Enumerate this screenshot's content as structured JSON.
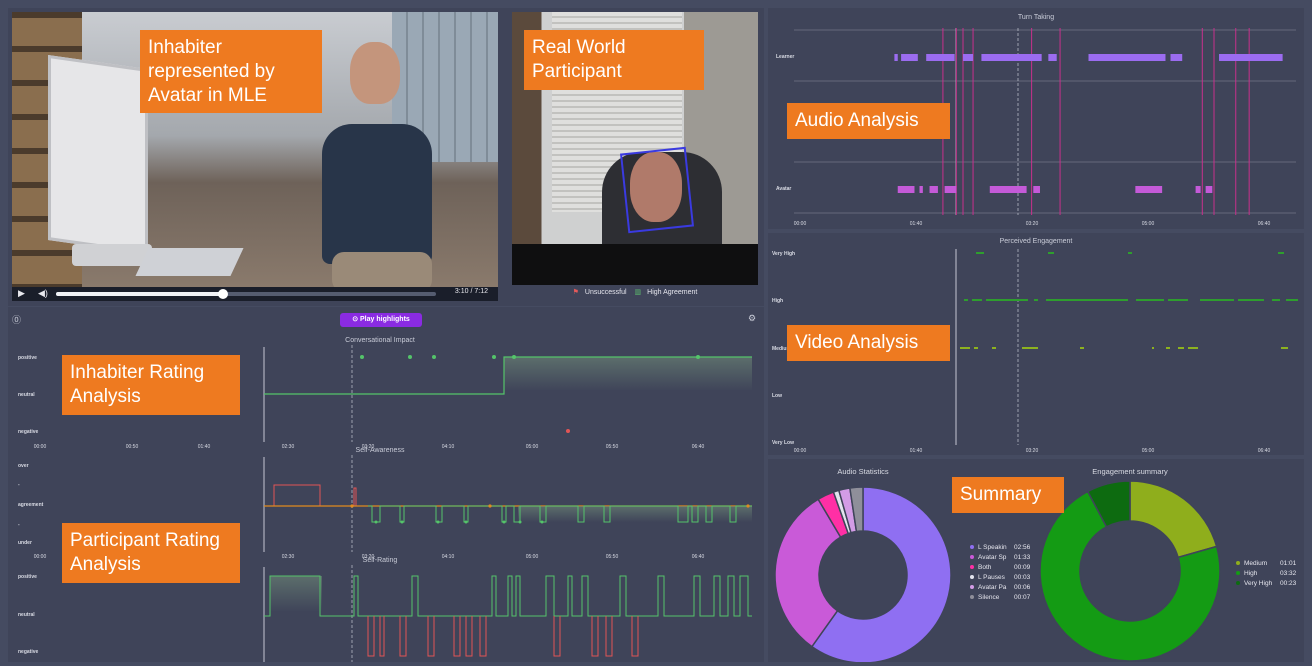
{
  "video_player": {
    "play_icon": "play-icon",
    "volume_icon": "volume-icon",
    "time_current": "3:10",
    "time_separator": "/",
    "time_total": "7:12",
    "progress_fraction": 0.44
  },
  "camera": {
    "legend_unsuccessful": "Unsuccessful",
    "legend_high_agreement": "High Agreement"
  },
  "toolbar": {
    "play_highlights": "Play highlights",
    "help_icon": "help-icon",
    "settings_icon": "gear-icon"
  },
  "overlays": {
    "inhabiter_avatar": "Inhabiter represented by Avatar in MLE",
    "real_world": "Real World Participant",
    "audio_analysis": "Audio Analysis",
    "video_analysis": "Video Analysis",
    "inhabiter_rating": "Inhabiter Rating Analysis",
    "participant_rating": "Participant Rating Analysis",
    "summary": "Summary"
  },
  "colors": {
    "accent_purple": "#8a2be2",
    "overlay_orange": "#ee7a20",
    "learner": "#9b6cf0",
    "avatar": "#c45ad8",
    "engagement_green": "#2e9e2e",
    "engagement_lime": "#8db21f",
    "rating_green": "#54c46a",
    "rating_red": "#e25555",
    "rating_orange": "#e08a1f"
  },
  "chart_data": [
    {
      "type": "line",
      "title": "Turn Taking",
      "categories": [
        "Learner",
        "Avatar"
      ],
      "x_ticks": [
        "00:00",
        "01:40",
        "03:20",
        "05:00",
        "06:40"
      ],
      "series": [
        {
          "name": "Learner",
          "segments": [
            [
              3.0,
              3.1
            ],
            [
              3.2,
              3.7
            ],
            [
              3.95,
              4.8
            ],
            [
              5.05,
              5.35
            ],
            [
              5.6,
              7.4
            ],
            [
              7.6,
              7.85
            ],
            [
              8.8,
              11.1
            ],
            [
              11.25,
              11.6
            ],
            [
              12.7,
              14.6
            ]
          ]
        },
        {
          "name": "Avatar",
          "segments": [
            [
              3.1,
              3.6
            ],
            [
              3.75,
              3.85
            ],
            [
              4.05,
              4.3
            ],
            [
              4.5,
              4.85
            ],
            [
              5.85,
              6.95
            ],
            [
              7.15,
              7.35
            ],
            [
              10.2,
              11.0
            ],
            [
              12.0,
              12.15
            ],
            [
              12.3,
              12.5
            ]
          ]
        }
      ],
      "highlight_lines": [
        4.45,
        4.85,
        5.05,
        5.35,
        7.1,
        7.95,
        12.2,
        12.55,
        13.2,
        13.6
      ]
    },
    {
      "type": "scatter",
      "title": "Perceived Engagement",
      "y_categories": [
        "Very High",
        "High",
        "Medium",
        "Low",
        "Very Low"
      ],
      "x_ticks": [
        "00:00",
        "01:40",
        "03:20",
        "05:00",
        "06:40"
      ]
    },
    {
      "type": "line",
      "title": "Conversational Impact",
      "y_categories": [
        "positive",
        "neutral",
        "negative"
      ],
      "x_ticks": [
        "00:00",
        "00:50",
        "01:40",
        "02:30",
        "03:20",
        "04:10",
        "05:00",
        "05:50",
        "06:40"
      ]
    },
    {
      "type": "line",
      "title": "Self-Awareness",
      "y_categories": [
        "over",
        "-",
        "agreement",
        "-",
        "under"
      ],
      "x_ticks": [
        "00:00",
        "00:50",
        "01:40",
        "02:30",
        "03:20",
        "04:10",
        "05:00",
        "05:50",
        "06:40"
      ]
    },
    {
      "type": "line",
      "title": "Self-Rating",
      "y_categories": [
        "positive",
        "neutral",
        "negative"
      ],
      "x_ticks": [
        "00:00",
        "00:50",
        "01:40",
        "02:30",
        "03:20",
        "04:10",
        "05:00",
        "05:50",
        "06:40"
      ]
    },
    {
      "type": "pie",
      "title": "Audio Statistics",
      "slices": [
        {
          "label": "L Speakin",
          "value": "02:56",
          "seconds": 176,
          "color": "#8f6ff2"
        },
        {
          "label": "Avatar Sp",
          "value": "01:33",
          "seconds": 93,
          "color": "#c95ad8"
        },
        {
          "label": "Both",
          "value": "00:09",
          "seconds": 9,
          "color": "#ff2fa5"
        },
        {
          "label": "L Pauses",
          "value": "00:03",
          "seconds": 3,
          "color": "#e3e4ee"
        },
        {
          "label": "Avatar Pa",
          "value": "00:06",
          "seconds": 6,
          "color": "#d39ce6"
        },
        {
          "label": "Silence",
          "value": "00:07",
          "seconds": 7,
          "color": "#8f8f9a"
        }
      ]
    },
    {
      "type": "pie",
      "title": "Engagement summary",
      "slices": [
        {
          "label": "Medium",
          "value": "01:01",
          "seconds": 61,
          "color": "#8fae1c"
        },
        {
          "label": "High",
          "value": "03:32",
          "seconds": 212,
          "color": "#149b14"
        },
        {
          "label": "Very High",
          "value": "00:23",
          "seconds": 23,
          "color": "#0d6b10"
        }
      ]
    }
  ]
}
